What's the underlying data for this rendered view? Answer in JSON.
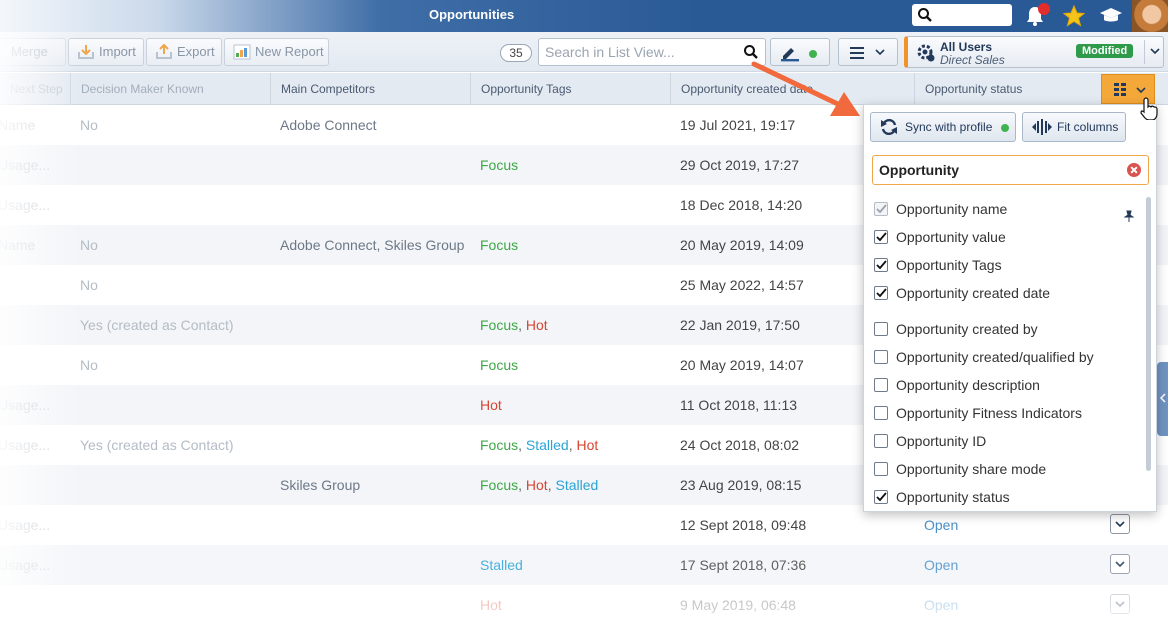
{
  "titlebar": {
    "title": "Opportunities"
  },
  "toolbar": {
    "merge_label": "Merge",
    "import_label": "Import",
    "export_label": "Export",
    "new_report_label": "New Report",
    "record_count": "35",
    "search_placeholder": "Search in List View...",
    "profile": {
      "title": "All Users",
      "subtitle": "Direct Sales",
      "badge": "Modified"
    }
  },
  "columns": {
    "ghost": "Next Step",
    "decision_maker": "Decision Maker Known",
    "main_competitors": "Main Competitors",
    "opportunity_tags": "Opportunity Tags",
    "created_date": "Opportunity created date",
    "status": "Opportunity status"
  },
  "rows": [
    {
      "ghost": "Name",
      "decision_maker": "No",
      "competitors": "Adobe Connect",
      "tags": [],
      "date": "19 Jul 2021, 19:17",
      "status": ""
    },
    {
      "ghost": "Usage...",
      "decision_maker": "",
      "competitors": "",
      "tags": [
        "Focus"
      ],
      "date": "29 Oct 2019, 17:27",
      "status": ""
    },
    {
      "ghost": "Usage...",
      "decision_maker": "",
      "competitors": "",
      "tags": [],
      "date": "18 Dec 2018, 14:20",
      "status": ""
    },
    {
      "ghost": "Name",
      "decision_maker": "No",
      "competitors": "Adobe Connect, Skiles Group",
      "tags": [
        "Focus"
      ],
      "date": "20 May 2019, 14:09",
      "status": ""
    },
    {
      "ghost": "",
      "decision_maker": "No",
      "competitors": "",
      "tags": [],
      "date": "25 May 2022, 14:57",
      "status": ""
    },
    {
      "ghost": "",
      "decision_maker": "Yes (created as Contact)",
      "competitors": "",
      "tags": [
        "Focus",
        "Hot"
      ],
      "date": "22 Jan 2019, 17:50",
      "status": ""
    },
    {
      "ghost": "",
      "decision_maker": "No",
      "competitors": "",
      "tags": [
        "Focus"
      ],
      "date": "20 May 2019, 14:07",
      "status": ""
    },
    {
      "ghost": "Usage...",
      "decision_maker": "",
      "competitors": "",
      "tags": [
        "Hot"
      ],
      "date": "11 Oct 2018, 11:13",
      "status": ""
    },
    {
      "ghost": "Usage...",
      "decision_maker": "Yes (created as Contact)",
      "competitors": "",
      "tags": [
        "Focus",
        "Stalled",
        "Hot"
      ],
      "date": "24 Oct 2018, 08:02",
      "status": ""
    },
    {
      "ghost": "",
      "decision_maker": "",
      "competitors": "Skiles Group",
      "tags": [
        "Focus",
        "Hot",
        "Stalled"
      ],
      "date": "23 Aug 2019, 08:15",
      "status": ""
    },
    {
      "ghost": "Usage...",
      "decision_maker": "",
      "competitors": "",
      "tags": [],
      "date": "12 Sept 2018, 09:48",
      "status": "Open"
    },
    {
      "ghost": "Usage...",
      "decision_maker": "",
      "competitors": "",
      "tags": [
        "Stalled"
      ],
      "date": "17 Sept 2018, 07:36",
      "status": "Open"
    },
    {
      "ghost": "",
      "decision_maker": "",
      "competitors": "",
      "tags": [
        "Hot"
      ],
      "date": "9 May 2019, 06:48",
      "status": "Open"
    }
  ],
  "tag_colors": {
    "Focus": "#3da846",
    "Hot": "#d64631",
    "Stalled": "#2aa3d8"
  },
  "column_panel": {
    "sync_label": "Sync with profile",
    "fit_label": "Fit columns",
    "filter_value": "Opportunity",
    "options": [
      {
        "label": "Opportunity name",
        "checked": true,
        "disabled": true,
        "pinned": true
      },
      {
        "label": "Opportunity value",
        "checked": true
      },
      {
        "label": "Opportunity Tags",
        "checked": true
      },
      {
        "label": "Opportunity created date",
        "checked": true
      },
      {
        "label": "Opportunity created by",
        "checked": false
      },
      {
        "label": "Opportunity created/qualified by",
        "checked": false
      },
      {
        "label": "Opportunity description",
        "checked": false
      },
      {
        "label": "Opportunity Fitness Indicators",
        "checked": false
      },
      {
        "label": "Opportunity ID",
        "checked": false
      },
      {
        "label": "Opportunity share mode",
        "checked": false
      },
      {
        "label": "Opportunity status",
        "checked": true
      }
    ]
  },
  "colors": {
    "accent_orange": "#f5a83a",
    "arrow": "#f06a3d",
    "header_blue": "#2a5a96",
    "status_green": "#2e9a4a"
  }
}
